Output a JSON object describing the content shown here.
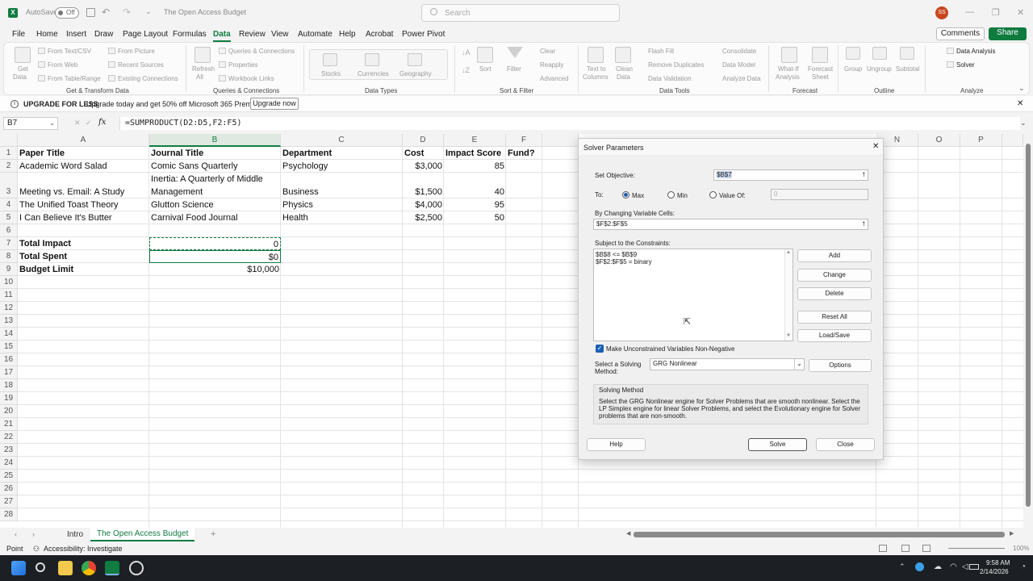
{
  "titlebar": {
    "autosave_label": "AutoSave",
    "autosave_state": "Off",
    "doc_title": "The Open Access Budget",
    "search_placeholder": "Search",
    "avatar_initials": "SS"
  },
  "menu": {
    "items": [
      "File",
      "Home",
      "Insert",
      "Draw",
      "Page Layout",
      "Formulas",
      "Data",
      "Review",
      "View",
      "Automate",
      "Help",
      "Acrobat",
      "Power Pivot"
    ],
    "active": "Data",
    "comments": "Comments",
    "share": "Share"
  },
  "ribbon": {
    "get_data": [
      "Get",
      "Data"
    ],
    "get_transform": [
      "From Text/CSV",
      "From Web",
      "From Table/Range"
    ],
    "get_transform2": [
      "From Picture",
      "Recent Sources",
      "Existing Connections"
    ],
    "refresh": [
      "Refresh",
      "All"
    ],
    "queries": [
      "Queries & Connections",
      "Properties",
      "Workbook Links"
    ],
    "data_types": [
      "Stocks",
      "Currencies",
      "Geography"
    ],
    "sort": "Sort",
    "filter": "Filter",
    "filter_opts": [
      "Clear",
      "Reapply",
      "Advanced"
    ],
    "text_to_columns": [
      "Text to",
      "Columns"
    ],
    "clean_data": [
      "Clean",
      "Data"
    ],
    "data_tools": [
      "Flash Fill",
      "Remove Duplicates",
      "Data Validation"
    ],
    "data_tools2": [
      "Consolidate",
      "Data Model",
      "Analyze Data"
    ],
    "what_if": [
      "What-If",
      "Analysis"
    ],
    "forecast_sheet": [
      "Forecast",
      "Sheet"
    ],
    "outline": [
      "Group",
      "Ungroup",
      "Subtotal"
    ],
    "analyze": [
      "Data Analysis",
      "Solver"
    ],
    "groups": [
      "Get & Transform Data",
      "Queries & Connections",
      "Data Types",
      "Sort & Filter",
      "Data Tools",
      "Forecast",
      "Outline",
      "Analyze"
    ]
  },
  "upgrade": {
    "title": "UPGRADE FOR LESS",
    "message": "Upgrade today and get 50% off Microsoft 365 Premium.",
    "button": "Upgrade now"
  },
  "formula": {
    "name_box": "B7",
    "fx": "fx",
    "content": "=SUMPRODUCT(D2:D5,F2:F5)"
  },
  "grid": {
    "columns": [
      "A",
      "B",
      "C",
      "D",
      "E",
      "F",
      "",
      "",
      "",
      "",
      "",
      "",
      "",
      "N",
      "O",
      "P",
      "Q"
    ],
    "rows": [
      "1",
      "2",
      "3",
      "4",
      "5",
      "6",
      "7",
      "8",
      "9",
      "10",
      "11",
      "12",
      "13",
      "14",
      "15",
      "16",
      "17",
      "18",
      "19",
      "20",
      "21",
      "22",
      "23",
      "24",
      "25",
      "26",
      "27",
      "28"
    ],
    "headers": [
      "Paper Title",
      "Journal Title",
      "Department",
      "Cost",
      "Impact Score",
      "Fund?"
    ],
    "data": [
      [
        "Academic Word Salad",
        "Comic Sans Quarterly",
        "Psychology",
        "$3,000",
        "85"
      ],
      [
        "Meeting vs. Email: A Study",
        "Inertia: A Quarterly of Middle",
        "Management",
        "Business",
        "$1,500",
        "40"
      ],
      [
        "The Unified Toast Theory",
        "Glutton Science",
        "Physics",
        "$4,000",
        "95"
      ],
      [
        "I Can Believe It's Butter",
        "Carnival Food Journal",
        "Health",
        "$2,500",
        "50"
      ]
    ],
    "total_impact_label": "Total Impact",
    "total_impact_value": "0",
    "total_spent_label": "Total Spent",
    "total_spent_value": "$0",
    "budget_label": "Budget Limit",
    "budget_value": "$10,000"
  },
  "solver": {
    "title": "Solver Parameters",
    "set_objective_label": "Set Objective:",
    "set_objective_value": "$B$7",
    "to_label": "To:",
    "max": "Max",
    "min": "Min",
    "value_of": "Value Of:",
    "value_of_value": "0",
    "changing_label": "By Changing Variable Cells:",
    "changing_value": "$F$2:$F$5",
    "constraints_label": "Subject to the Constraints:",
    "constraints": [
      "$B$8 <= $B$9",
      "$F$2:$F$5 = binary"
    ],
    "add": "Add",
    "change": "Change",
    "delete": "Delete",
    "reset_all": "Reset All",
    "load_save": "Load/Save",
    "nonneg": "Make Unconstrained Variables Non-Negative",
    "method_label_1": "Select a Solving",
    "method_label_2": "Method:",
    "method_value": "GRG Nonlinear",
    "options": "Options",
    "solving_method_title": "Solving Method",
    "solving_method_text": "Select the GRG Nonlinear engine for Solver Problems that are smooth nonlinear. Select the LP Simplex engine for linear Solver Problems, and select the Evolutionary engine for Solver problems that are non-smooth.",
    "help": "Help",
    "solve": "Solve",
    "close": "Close"
  },
  "tabs": {
    "items": [
      "Intro",
      "The Open Access Budget"
    ],
    "active": "The Open Access Budget"
  },
  "status": {
    "mode": "Point",
    "accessibility": "Accessibility: Investigate",
    "zoom": "100%"
  },
  "taskbar": {
    "time": "9:58 AM",
    "date": "2/14/2026"
  },
  "colors": {
    "excel_green": "#107c41",
    "share_green": "#0f7b3f",
    "accent_blue": "#1a5fb4"
  }
}
